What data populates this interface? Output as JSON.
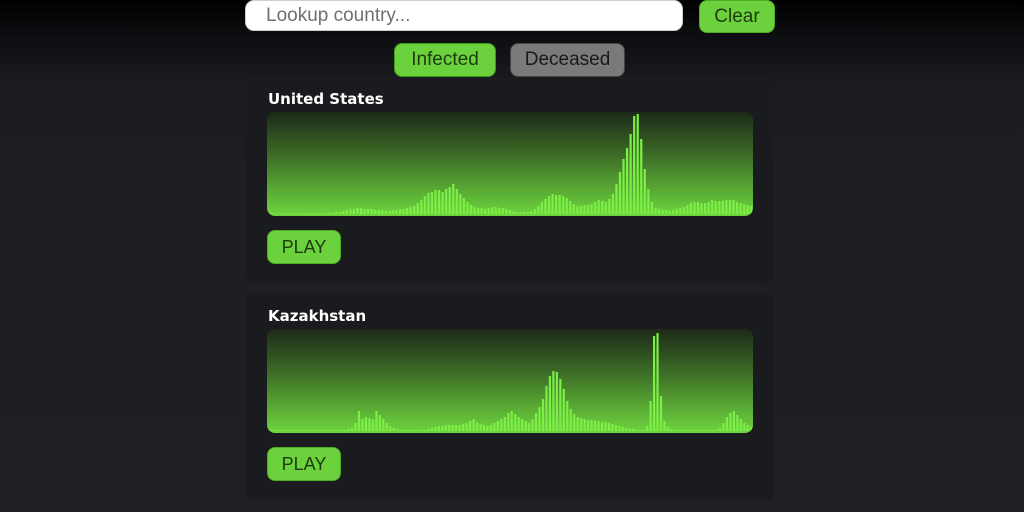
{
  "search": {
    "placeholder": "Lookup country...",
    "value": "",
    "clear_label": "Clear"
  },
  "tabs": [
    {
      "label": "Infected",
      "active": true
    },
    {
      "label": "Deceased",
      "active": false
    }
  ],
  "colors": {
    "accent": "#6bd23d",
    "bar": "#7cf046",
    "inactive_tab": "#7a7a7a",
    "card_bg": "#1a1b1f"
  },
  "cards": [
    {
      "country": "United States",
      "play_label": "PLAY"
    },
    {
      "country": "Kazakhstan",
      "play_label": "PLAY"
    }
  ],
  "chart_data": [
    {
      "type": "bar",
      "name": "United States",
      "ylim": [
        0,
        100
      ],
      "values": [
        0,
        0,
        0,
        0,
        0,
        0,
        0,
        0,
        0,
        0,
        0,
        0,
        1,
        1,
        1,
        1,
        1,
        1,
        1,
        2,
        2,
        3,
        4,
        5,
        5,
        6,
        6,
        5,
        5,
        5,
        4,
        4,
        4,
        3,
        3,
        4,
        4,
        5,
        5,
        6,
        7,
        8,
        11,
        14,
        18,
        21,
        22,
        24,
        24,
        22,
        25,
        27,
        30,
        25,
        20,
        16,
        12,
        9,
        7,
        6,
        6,
        5,
        6,
        7,
        7,
        6,
        6,
        5,
        4,
        3,
        2,
        2,
        2,
        2,
        3,
        5,
        8,
        12,
        15,
        18,
        20,
        19,
        19,
        18,
        16,
        13,
        10,
        8,
        8,
        9,
        9,
        10,
        12,
        14,
        13,
        12,
        15,
        20,
        30,
        42,
        55,
        66,
        80,
        98,
        100,
        75,
        45,
        25,
        12,
        6,
        5,
        4,
        4,
        3,
        4,
        5,
        6,
        7,
        9,
        11,
        12,
        12,
        11,
        11,
        12,
        14,
        13,
        13,
        13,
        14,
        14,
        14,
        12,
        11,
        10,
        9,
        8
      ]
    },
    {
      "type": "bar",
      "name": "Kazakhstan",
      "ylim": [
        0,
        100
      ],
      "values": [
        0,
        0,
        0,
        0,
        0,
        0,
        0,
        0,
        0,
        0,
        0,
        0,
        0,
        0,
        0,
        0,
        0,
        0,
        0,
        0,
        0,
        0,
        1,
        2,
        3,
        8,
        20,
        12,
        14,
        13,
        12,
        20,
        16,
        12,
        8,
        5,
        3,
        2,
        1,
        1,
        1,
        1,
        1,
        1,
        1,
        1,
        2,
        3,
        4,
        5,
        5,
        6,
        6,
        6,
        6,
        6,
        7,
        8,
        10,
        12,
        9,
        7,
        6,
        5,
        6,
        8,
        10,
        12,
        14,
        18,
        20,
        17,
        14,
        12,
        10,
        8,
        12,
        18,
        24,
        32,
        45,
        55,
        60,
        59,
        52,
        42,
        30,
        22,
        17,
        14,
        13,
        12,
        11,
        11,
        10,
        10,
        9,
        9,
        8,
        7,
        6,
        5,
        4,
        3,
        2,
        2,
        1,
        1,
        1,
        5,
        30,
        95,
        98,
        35,
        10,
        4,
        2,
        1,
        1,
        0,
        0,
        0,
        0,
        0,
        0,
        0,
        0,
        0,
        0,
        1,
        3,
        8,
        14,
        18,
        20,
        16,
        12,
        8,
        6,
        4
      ]
    }
  ]
}
